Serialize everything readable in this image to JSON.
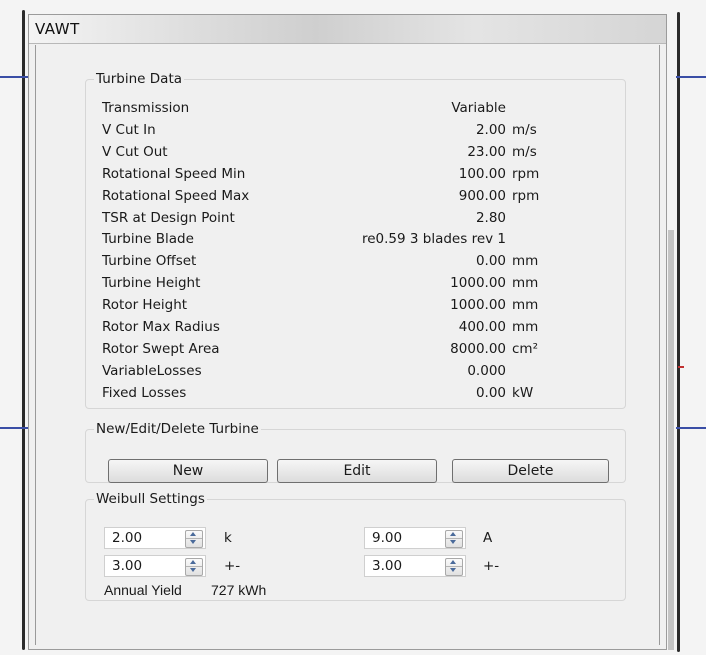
{
  "window": {
    "title": "VAWT"
  },
  "turbine_data": {
    "title": "Turbine Data",
    "rows": [
      {
        "label": "Transmission",
        "value": "Variable",
        "unit": ""
      },
      {
        "label": "V Cut In",
        "value": "2.00",
        "unit": "m/s"
      },
      {
        "label": "V Cut Out",
        "value": "23.00",
        "unit": "m/s"
      },
      {
        "label": "Rotational Speed Min",
        "value": "100.00",
        "unit": "rpm"
      },
      {
        "label": "Rotational Speed Max",
        "value": "900.00",
        "unit": "rpm"
      },
      {
        "label": "TSR at Design Point",
        "value": "2.80",
        "unit": ""
      },
      {
        "label": "Turbine Blade",
        "value": "re0.59 3 blades rev 1",
        "unit": ""
      },
      {
        "label": "Turbine Offset",
        "value": "0.00",
        "unit": "mm"
      },
      {
        "label": "Turbine Height",
        "value": "1000.00",
        "unit": "mm"
      },
      {
        "label": "Rotor Height",
        "value": "1000.00",
        "unit": "mm"
      },
      {
        "label": "Rotor Max Radius",
        "value": "400.00",
        "unit": "mm"
      },
      {
        "label": "Rotor Swept Area",
        "value": "8000.00",
        "unit": "cm²"
      },
      {
        "label": "VariableLosses",
        "value": "0.000",
        "unit": ""
      },
      {
        "label": "Fixed Losses",
        "value": "0.00",
        "unit": "kW"
      }
    ]
  },
  "turbine_actions": {
    "title": "New/Edit/Delete Turbine",
    "new_label": "New",
    "edit_label": "Edit",
    "delete_label": "Delete"
  },
  "weibull": {
    "title": "Weibull Settings",
    "k_value": "2.00",
    "k_label": "k",
    "a_value": "9.00",
    "a_label": "A",
    "k_tol_value": "3.00",
    "k_tol_label": "+-",
    "a_tol_value": "3.00",
    "a_tol_label": "+-",
    "annual_yield_label": "Annual Yield",
    "annual_yield_value": "727 kWh"
  }
}
